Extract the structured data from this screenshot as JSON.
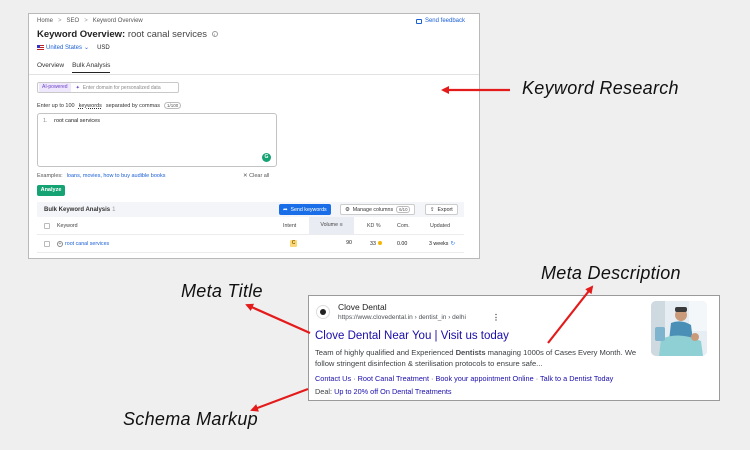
{
  "panel": {
    "breadcrumb": [
      "Home",
      "SEO",
      "Keyword Overview"
    ],
    "breadcrumb_sep": ">",
    "feedback": "Send feedback",
    "title_prefix": "Keyword Overview:",
    "title_keyword": "root canal services",
    "country": "United States",
    "currency": "USD",
    "tabs": [
      {
        "label": "Overview"
      },
      {
        "label": "Bulk Analysis"
      }
    ],
    "ai_badge": "AI-powered",
    "ai_placeholder": "Enter domain for personalized data",
    "enter_prefix": "Enter up to 100",
    "enter_keywords": "keywords",
    "enter_suffix": "separated by commas",
    "enter_counter": "1/100",
    "textarea_num": "1.",
    "textarea_value": "root canal services",
    "examples_label": "Examples:",
    "examples_links": "loans, movies, how to buy audible books",
    "clear_all": "Clear all",
    "analyze": "Analyze",
    "bulk_title": "Bulk Keyword Analysis",
    "bulk_count": "1",
    "send_keywords": "Send keywords",
    "manage_columns": "Manage columns",
    "manage_count": "6/10",
    "export": "Export",
    "columns": {
      "keyword": "Keyword",
      "intent": "Intent",
      "volume": "Volume",
      "kd": "KD %",
      "com": "Com.",
      "updated": "Updated"
    },
    "row": {
      "keyword": "root canal services",
      "intent": "C",
      "volume": "90",
      "kd": "33",
      "com": "0.00",
      "updated": "3 weeks"
    }
  },
  "serp": {
    "site_name": "Clove Dental",
    "url": "https://www.clovedental.in › dentist_in › delhi",
    "title": "Clove Dental Near You | Visit us today",
    "desc_1": "Team of highly qualified and Experienced ",
    "desc_hl": "Dentists",
    "desc_2": " managing 1000s of Cases Every Month. We follow stringent disinfection & sterilisation protocols to ensure safe...",
    "sitelinks": [
      "Contact Us",
      "Root Canal Treatment",
      "Book your appointment Online",
      "Talk to a Dentist Today"
    ],
    "deal_label": "Deal:",
    "deal_link": "Up to 20% off On Dental Treatments"
  },
  "labels": {
    "keyword_research": "Keyword Research",
    "meta_description": "Meta Description",
    "meta_title": "Meta Title",
    "schema_markup": "Schema Markup"
  },
  "colors": {
    "arrow": "#e41b1b",
    "link_blue": "#1a0dab",
    "semrush_green": "#15a374",
    "semrush_blue": "#1a6fe8"
  }
}
